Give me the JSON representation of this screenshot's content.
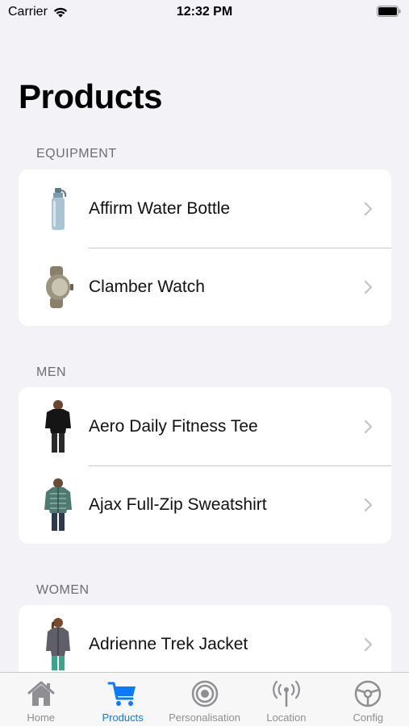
{
  "status_bar": {
    "carrier": "Carrier",
    "time": "12:32 PM"
  },
  "title": "Products",
  "sections": [
    {
      "header": "EQUIPMENT",
      "items": [
        {
          "label": "Affirm Water Bottle"
        },
        {
          "label": "Clamber Watch"
        }
      ]
    },
    {
      "header": "MEN",
      "items": [
        {
          "label": "Aero Daily Fitness Tee"
        },
        {
          "label": "Ajax Full-Zip Sweatshirt"
        }
      ]
    },
    {
      "header": "WOMEN",
      "items": [
        {
          "label": "Adrienne Trek Jacket"
        }
      ]
    }
  ],
  "tab_bar": {
    "active_color": "#0a7aff",
    "inactive_color": "#8e8e93",
    "tabs": [
      {
        "label": "Home",
        "icon": "home-icon"
      },
      {
        "label": "Products",
        "icon": "cart-icon"
      },
      {
        "label": "Personalisation",
        "icon": "target-icon"
      },
      {
        "label": "Location",
        "icon": "antenna-icon"
      },
      {
        "label": "Config",
        "icon": "steering-wheel-icon"
      }
    ]
  }
}
